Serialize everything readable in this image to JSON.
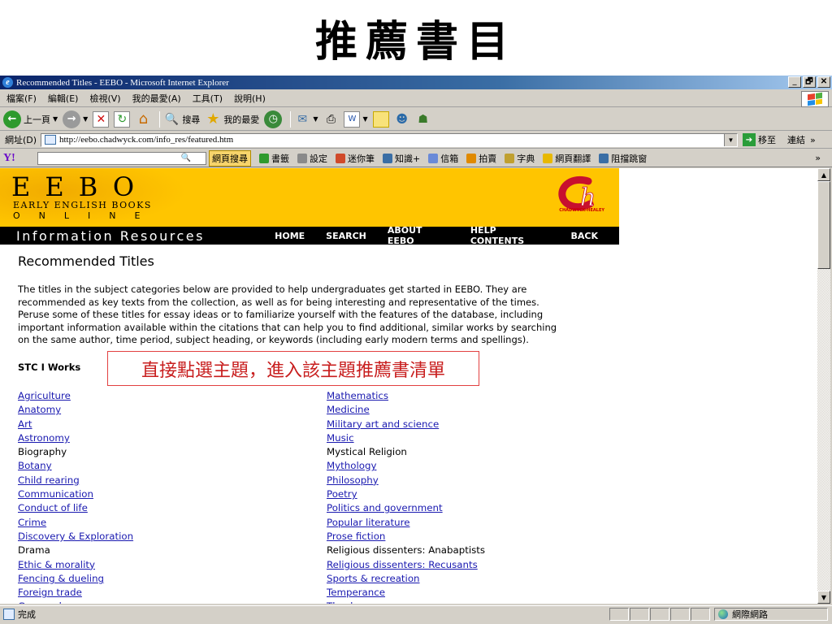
{
  "slide": {
    "title": "推薦書目"
  },
  "window": {
    "title": "Recommended Titles - EEBO - Microsoft Internet Explorer",
    "controls": [
      "_",
      "🗗",
      "✕"
    ]
  },
  "menu": [
    "檔案(F)",
    "編輯(E)",
    "檢視(V)",
    "我的最愛(A)",
    "工具(T)",
    "說明(H)"
  ],
  "toolbar": {
    "back": "上一頁",
    "search": "搜尋",
    "favorites": "我的最愛"
  },
  "address": {
    "label": "網址(D)",
    "url": "http://eebo.chadwyck.com/info_res/featured.htm",
    "go": "移至",
    "links": "連結",
    "more": "»"
  },
  "yahoo_bar": {
    "logo": "Y!",
    "search_button": "網頁搜尋",
    "items": [
      "書籤",
      "設定",
      "迷你筆",
      "知識+",
      "信箱",
      "拍賣",
      "字典",
      "網頁翻譯",
      "阻擋跳窗"
    ],
    "more": "»"
  },
  "eebo": {
    "logo_word": "EEBO",
    "logo_sub": "EARLY ENGLISH BOOKS",
    "logo_online": "ONLINE",
    "publisher": "CHADWYCK-HEALEY",
    "publisher_mark": "ch",
    "nav_title": "Information Resources",
    "nav_links": [
      "HOME",
      "SEARCH",
      "ABOUT EEBO",
      "HELP CONTENTS",
      "BACK"
    ]
  },
  "content": {
    "heading": "Recommended Titles",
    "intro_lines": [
      "The titles in the subject categories below are provided to help undergraduates get started in EEBO. They are",
      "recommended as key texts from the collection, as well as for being interesting and representative of the times.",
      "Peruse some of these titles for essay ideas or to familiarize yourself with the features of the database, including",
      "important information available within the citations that can help you to find additional, similar works by searching",
      "on the same author, time period, subject heading, or keywords (including early modern terms and spellings)."
    ],
    "section": "STC I Works",
    "callout": "直接點選主題，進入該主題推薦書清單",
    "left_topics": [
      {
        "label": "Agriculture",
        "link": true
      },
      {
        "label": "Anatomy",
        "link": true
      },
      {
        "label": "Art",
        "link": true
      },
      {
        "label": "Astronomy",
        "link": true
      },
      {
        "label": "Biography",
        "link": false
      },
      {
        "label": "Botany",
        "link": true
      },
      {
        "label": "Child rearing",
        "link": true
      },
      {
        "label": "Communication",
        "link": true
      },
      {
        "label": "Conduct of life",
        "link": true
      },
      {
        "label": "Crime",
        "link": true
      },
      {
        "label": "Discovery & Exploration",
        "link": true
      },
      {
        "label": "Drama",
        "link": false
      },
      {
        "label": "Ethic & morality",
        "link": true
      },
      {
        "label": "Fencing & dueling",
        "link": true
      },
      {
        "label": "Foreign trade",
        "link": true
      },
      {
        "label": "Geography",
        "link": true
      }
    ],
    "right_topics": [
      {
        "label": "Mathematics",
        "link": true
      },
      {
        "label": "Medicine",
        "link": true
      },
      {
        "label": "Military art and science",
        "link": true
      },
      {
        "label": "Music",
        "link": true
      },
      {
        "label": "Mystical Religion",
        "link": false
      },
      {
        "label": "Mythology",
        "link": true
      },
      {
        "label": "Philosophy",
        "link": true
      },
      {
        "label": "Poetry",
        "link": true
      },
      {
        "label": "Politics and government",
        "link": true
      },
      {
        "label": "Popular literature",
        "link": true
      },
      {
        "label": "Prose fiction",
        "link": true
      },
      {
        "label": "Religious dissenters: Anabaptists",
        "link": false
      },
      {
        "label": "Religious dissenters: Recusants",
        "link": true
      },
      {
        "label": "Sports & recreation",
        "link": true
      },
      {
        "label": "Temperance",
        "link": true
      },
      {
        "label": "Theology",
        "link": true
      }
    ]
  },
  "status": {
    "text": "完成",
    "zone": "網際網路"
  },
  "colors": {
    "eebo_yellow": "#ffc500",
    "link_blue": "#1a1ab0",
    "callout_red": "#c81e1e"
  }
}
